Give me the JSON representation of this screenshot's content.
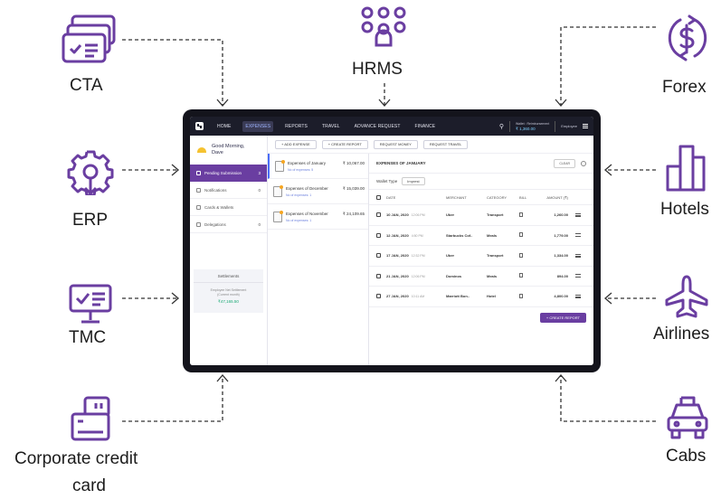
{
  "nodes": {
    "cta": {
      "label": "CTA",
      "icon": "ticket-icon"
    },
    "hrms": {
      "label": "HRMS",
      "icon": "people-icon"
    },
    "forex": {
      "label": "Forex",
      "icon": "currency-exchange-icon"
    },
    "erp": {
      "label": "ERP",
      "icon": "gear-network-icon"
    },
    "hotels": {
      "label": "Hotels",
      "icon": "buildings-icon"
    },
    "tmc": {
      "label": "TMC",
      "icon": "monitor-check-icon"
    },
    "airlines": {
      "label": "Airlines",
      "icon": "airplane-icon"
    },
    "card": {
      "label_line1": "Corporate credit",
      "label_line2": "card",
      "icon": "credit-card-icon"
    },
    "cabs": {
      "label": "Cabs",
      "icon": "car-icon"
    }
  },
  "colors": {
    "icon": "#6a3ea1",
    "frame": "#14141c",
    "accent": "#6a3ea1",
    "topbar": "#1c1d2a"
  },
  "app": {
    "nav": [
      "HOME",
      "EXPENSES",
      "REPORTS",
      "TRAVEL",
      "ADVANCE REQUEST",
      "FINANCE"
    ],
    "active_nav": "EXPENSES",
    "wallet_label": "Wallet : Reimbursement",
    "wallet_amount": "₹ 1,360.00",
    "user": "Employee",
    "greeting": "Good Morning, Dave",
    "sidebar": [
      {
        "label": "Pending Submission",
        "count": "3"
      },
      {
        "label": "Notifications",
        "count": "0"
      },
      {
        "label": "Cards & Wallets",
        "count": ""
      },
      {
        "label": "Delegations",
        "count": "0"
      }
    ],
    "settlements": {
      "title": "Settlements",
      "sub1": "Employee Net Settlement",
      "sub2": "(Current month)",
      "amount": "₹47,165.50"
    },
    "actions": [
      "+ ADD EXPENSE",
      "+ CREATE REPORT",
      "REQUEST MONEY",
      "REQUEST TRAVEL"
    ],
    "reports": [
      {
        "title": "Expenses of January",
        "amount": "₹ 10,067.00",
        "sub": "No of expenses: 5"
      },
      {
        "title": "Expenses of December",
        "amount": "₹ 15,039.00",
        "sub": "No of expenses: 1"
      },
      {
        "title": "Expenses of November",
        "amount": "₹ 24,109.65",
        "sub": "No of expenses: 1"
      }
    ],
    "detail_title": "EXPENSES OF JANUARY",
    "clear_label": "CLEAR",
    "wallet_type_label": "Wallet Type",
    "wallet_type_value": "Imprest",
    "columns": {
      "date": "DATE",
      "merchant": "MERCHANT",
      "category": "CATEGORY",
      "bill": "BILL",
      "amount": "AMOUNT (₹)"
    },
    "rows": [
      {
        "date": "10 JAN, 2020",
        "time": "12:06 PM",
        "merchant": "Uber",
        "category": "Transport",
        "amount": "1,260.00"
      },
      {
        "date": "12 JAN, 2020",
        "time": "4:50 PM",
        "merchant": "Starbucks Cof..",
        "category": "Meals",
        "amount": "1,779.00"
      },
      {
        "date": "17 JAN, 2020",
        "time": "12:32 PM",
        "merchant": "Uber",
        "category": "Transport",
        "amount": "1,334.00"
      },
      {
        "date": "21 JAN, 2020",
        "time": "12:06 PM",
        "merchant": "Dominos",
        "category": "Meals",
        "amount": "894.00"
      },
      {
        "date": "27 JAN, 2020",
        "time": "10:11 AM",
        "merchant": "Marriott Bon..",
        "category": "Hotel",
        "amount": "4,800.00"
      }
    ],
    "create_report": "+ CREATE REPORT"
  }
}
